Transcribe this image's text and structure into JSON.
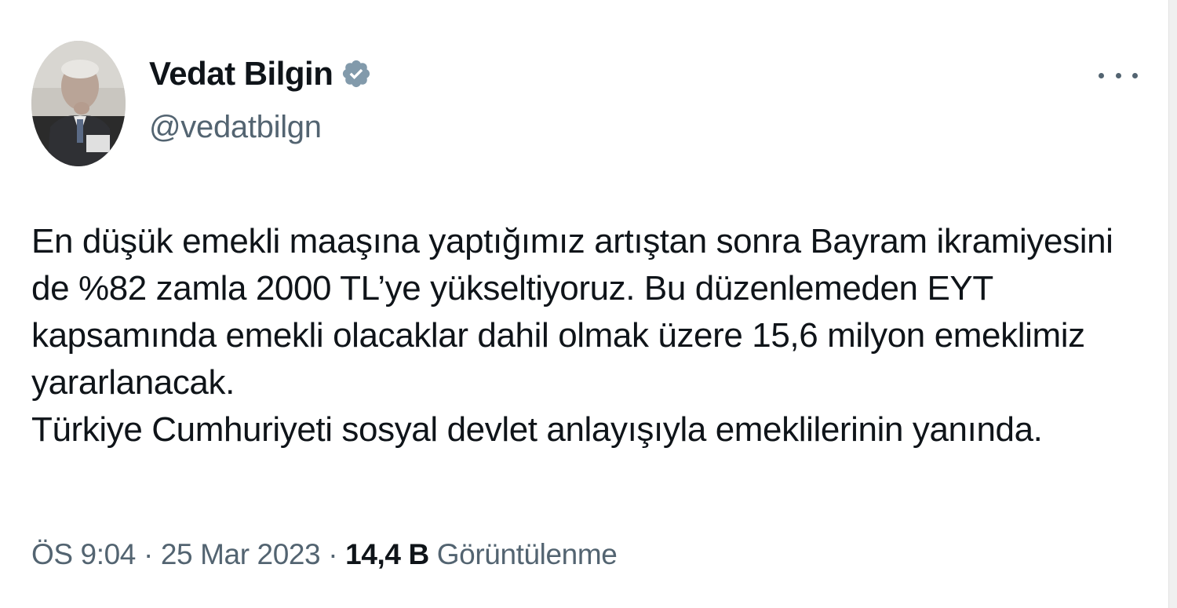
{
  "author": {
    "name": "Vedat Bilgin",
    "handle": "@vedatbilgn",
    "verified_icon": "verified-badge-icon",
    "verified_color": "#829aab"
  },
  "tweet": {
    "paragraph_1": "En düşük emekli maaşına yaptığımız artıştan sonra Bayram ikramiyesini de %82 zamla 2000 TL’ye yükseltiyoruz. Bu düzenlemeden EYT kapsamında emekli olacaklar dahil olmak üzere 15,6 milyon emeklimiz yararlanacak.",
    "paragraph_2": "Türkiye Cumhuriyeti sosyal devlet anlayışıyla emeklilerinin yanında."
  },
  "meta": {
    "time": "ÖS 9:04",
    "separator": "·",
    "date": "25 Mar 2023",
    "views_count": "14,4 B",
    "views_label": "Görüntülenme"
  },
  "actions": {
    "more_icon": "more-options-icon"
  }
}
